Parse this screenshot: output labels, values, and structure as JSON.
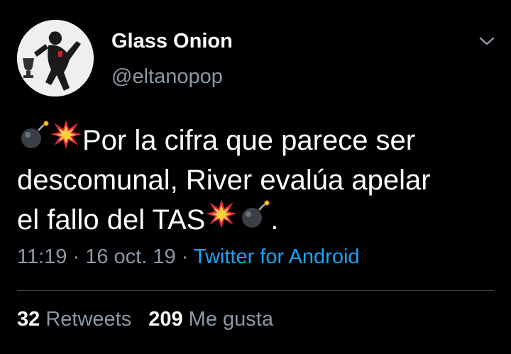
{
  "author": {
    "name": "Glass Onion",
    "handle": "@eltanopop"
  },
  "tweet": {
    "line1_text": "Por la cifra que parece ser",
    "line2_text": "descomunal, River evalúa apelar",
    "line3_text": "el fallo del TAS",
    "line3_end": ".",
    "emojis": [
      "bomb-icon",
      "collision-icon",
      "collision-icon",
      "bomb-icon"
    ]
  },
  "meta": {
    "time": "11:19",
    "sep1": " · ",
    "date": "16 oct. 19",
    "sep2": " · ",
    "source": "Twitter for Android"
  },
  "stats": {
    "retweets_count": "32",
    "retweets_label": "Retweets",
    "likes_count": "209",
    "likes_label": "Me gusta"
  },
  "colors": {
    "background": "#000000",
    "text": "#ffffff",
    "secondary": "#8b98a5",
    "link": "#1da1f2",
    "divider": "#38444d"
  }
}
